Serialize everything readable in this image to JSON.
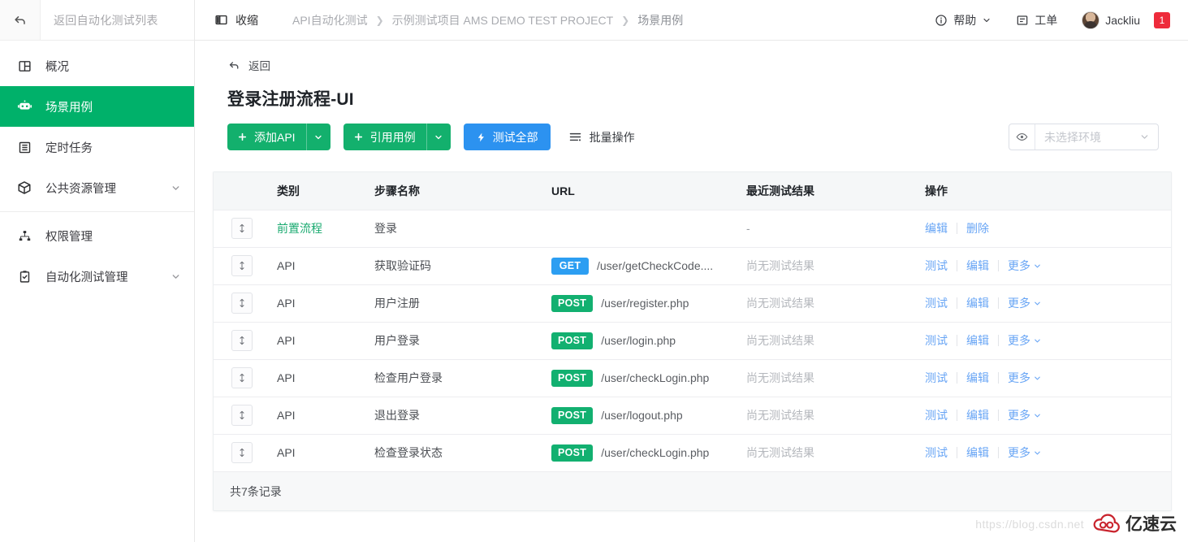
{
  "sidebar": {
    "back_label": "返回自动化测试列表",
    "back_icon": "undo-icon",
    "items": [
      {
        "label": "概况",
        "icon": "dashboard-icon",
        "active": false,
        "expandable": false
      },
      {
        "label": "场景用例",
        "icon": "robot-icon",
        "active": true,
        "expandable": false
      },
      {
        "label": "定时任务",
        "icon": "list-icon",
        "active": false,
        "expandable": false
      },
      {
        "label": "公共资源管理",
        "icon": "cube-icon",
        "active": false,
        "expandable": true
      },
      {
        "label": "权限管理",
        "icon": "sitemap-icon",
        "active": false,
        "expandable": true
      },
      {
        "label": "自动化测试管理",
        "icon": "clipboard-check-icon",
        "active": false,
        "expandable": true
      }
    ]
  },
  "header": {
    "collapse_label": "收缩",
    "collapse_icon": "panel-collapse-icon",
    "breadcrumb": [
      "API自动化测试",
      "示例测试项目 AMS DEMO TEST PROJECT",
      "场景用例"
    ],
    "help_label": "帮助",
    "help_icon": "info-circle-icon",
    "ticket_label": "工单",
    "ticket_icon": "ticket-icon",
    "user_name": "Jackliu",
    "notification_count": "1"
  },
  "main": {
    "back_label": "返回",
    "back_icon": "arrow-return-icon",
    "page_title": "登录注册流程-UI",
    "toolbar": {
      "add_api_label": "添加API",
      "quote_case_label": "引用用例",
      "test_all_label": "测试全部",
      "test_all_icon": "lightning-icon",
      "batch_label": "批量操作",
      "batch_icon": "batch-lines-icon"
    },
    "env_select": {
      "placeholder": "未选择环境",
      "icon": "eye-icon",
      "caret_icon": "chevron-down-icon"
    },
    "table": {
      "headers": [
        "",
        "类别",
        "步骤名称",
        "URL",
        "最近测试结果",
        "操作"
      ],
      "rows": [
        {
          "handle_icon": "drag-updown-icon",
          "category": "前置流程",
          "category_is_link": true,
          "step_name": "登录",
          "method": "",
          "url": "",
          "result": "-",
          "ops": [
            "编辑",
            "删除"
          ],
          "has_more": false
        },
        {
          "handle_icon": "drag-updown-icon",
          "category": "API",
          "category_is_link": false,
          "step_name": "获取验证码",
          "method": "GET",
          "url": "/user/getCheckCode....",
          "result": "尚无测试结果",
          "ops": [
            "测试",
            "编辑"
          ],
          "has_more": true,
          "more_label": "更多"
        },
        {
          "handle_icon": "drag-updown-icon",
          "category": "API",
          "category_is_link": false,
          "step_name": "用户注册",
          "method": "POST",
          "url": "/user/register.php",
          "result": "尚无测试结果",
          "ops": [
            "测试",
            "编辑"
          ],
          "has_more": true,
          "more_label": "更多"
        },
        {
          "handle_icon": "drag-updown-icon",
          "category": "API",
          "category_is_link": false,
          "step_name": "用户登录",
          "method": "POST",
          "url": "/user/login.php",
          "result": "尚无测试结果",
          "ops": [
            "测试",
            "编辑"
          ],
          "has_more": true,
          "more_label": "更多"
        },
        {
          "handle_icon": "drag-updown-icon",
          "category": "API",
          "category_is_link": false,
          "step_name": "检查用户登录",
          "method": "POST",
          "url": "/user/checkLogin.php",
          "result": "尚无测试结果",
          "ops": [
            "测试",
            "编辑"
          ],
          "has_more": true,
          "more_label": "更多"
        },
        {
          "handle_icon": "drag-updown-icon",
          "category": "API",
          "category_is_link": false,
          "step_name": "退出登录",
          "method": "POST",
          "url": "/user/logout.php",
          "result": "尚无测试结果",
          "ops": [
            "测试",
            "编辑"
          ],
          "has_more": true,
          "more_label": "更多"
        },
        {
          "handle_icon": "drag-updown-icon",
          "category": "API",
          "category_is_link": false,
          "step_name": "检查登录状态",
          "method": "POST",
          "url": "/user/checkLogin.php",
          "result": "尚无测试结果",
          "ops": [
            "测试",
            "编辑"
          ],
          "has_more": true,
          "more_label": "更多"
        }
      ],
      "footer_text": "共7条记录"
    }
  },
  "watermark": {
    "url_text": "https://blog.csdn.net",
    "brand_text": "亿速云",
    "brand_icon": "cloud-logo-icon"
  },
  "colors": {
    "sidebar_active": "#00b16a",
    "primary_green": "#13b06d",
    "primary_blue": "#2c92f0",
    "method_get": "#2c9ef2",
    "method_post": "#12b070",
    "link_blue": "#68a5f5",
    "badge_red": "#ee2b3b"
  }
}
